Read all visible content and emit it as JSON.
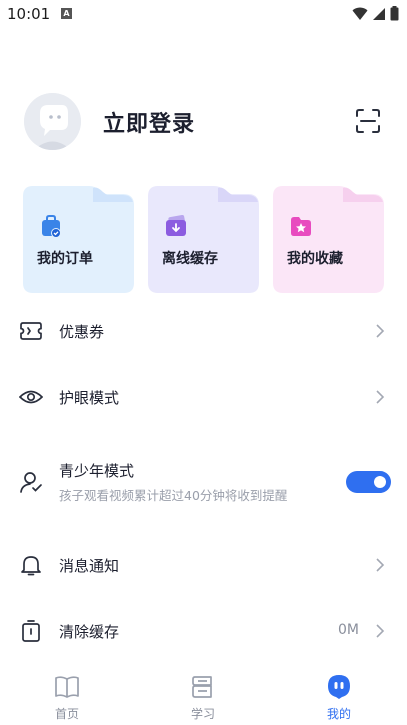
{
  "status_bar": {
    "time": "10:01",
    "notification_letter": "A"
  },
  "profile": {
    "login_label": "立即登录"
  },
  "cards": [
    {
      "label": "我的订单",
      "icon": "order-bag-icon",
      "color": "#e3f1fd"
    },
    {
      "label": "离线缓存",
      "icon": "download-folder-icon",
      "color": "#e9e8fc"
    },
    {
      "label": "我的收藏",
      "icon": "star-folder-icon",
      "color": "#fbe6f7"
    }
  ],
  "menu": {
    "coupon": {
      "label": "优惠券"
    },
    "eye_mode": {
      "label": "护眼模式"
    },
    "teen_mode": {
      "label": "青少年模式",
      "description": "孩子观看视频累计超过40分钟将收到提醒",
      "enabled": true
    },
    "notifications": {
      "label": "消息通知"
    },
    "clear_cache": {
      "label": "清除缓存",
      "value": "0M"
    }
  },
  "bottom_nav": [
    {
      "label": "首页",
      "active": false
    },
    {
      "label": "学习",
      "active": false
    },
    {
      "label": "我的",
      "active": true
    }
  ],
  "colors": {
    "accent": "#2f6ff0",
    "text": "#1c1f2e",
    "muted": "#8a8f9c"
  }
}
